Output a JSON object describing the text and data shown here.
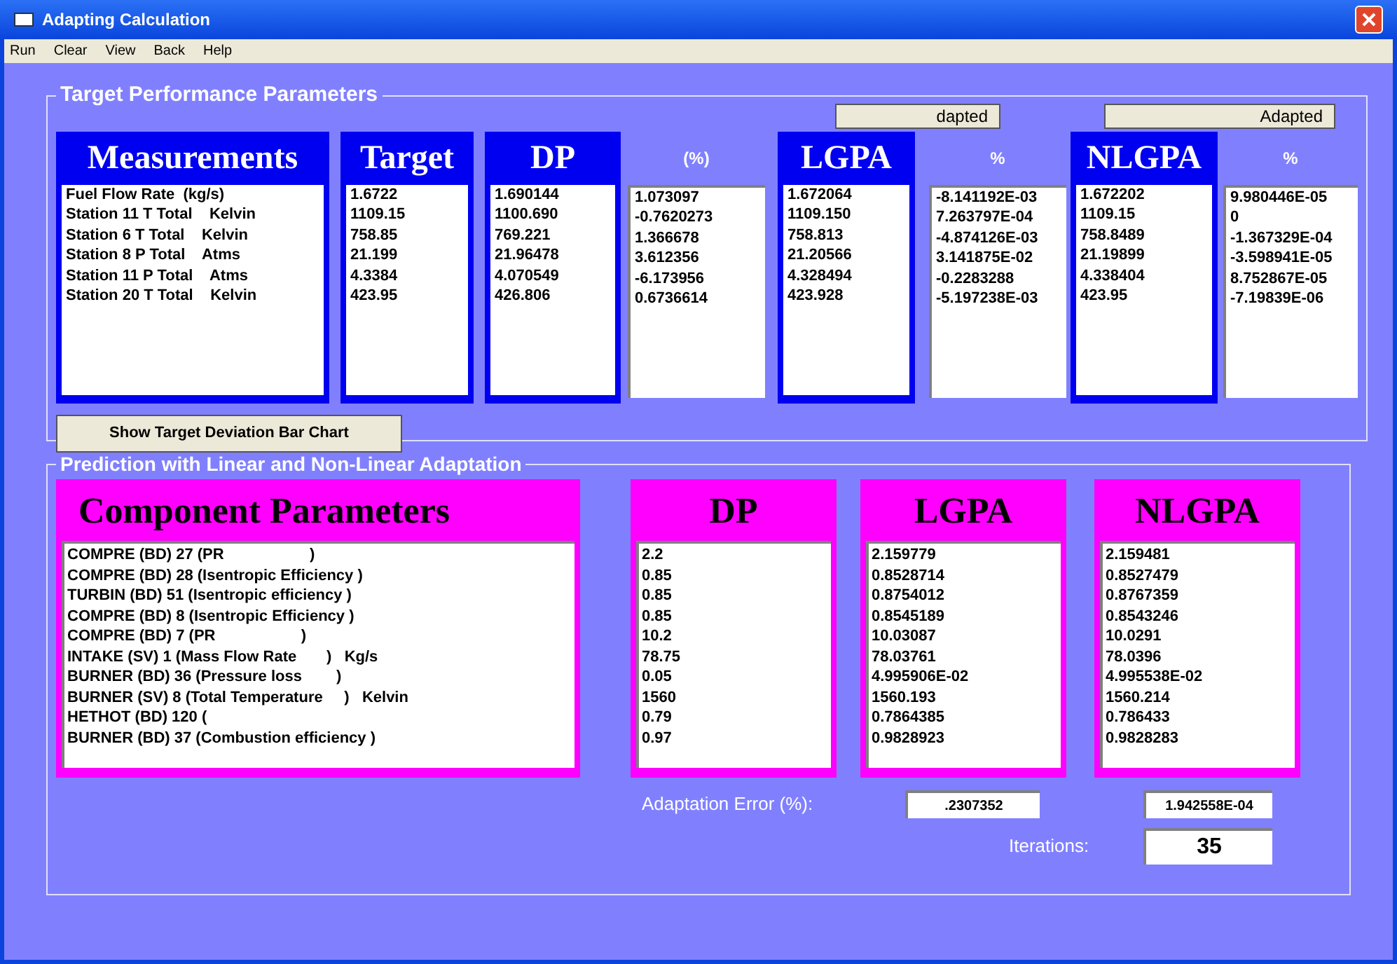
{
  "window": {
    "title": "Adapting Calculation"
  },
  "menu": [
    "Run",
    "Clear",
    "View",
    "Back",
    "Help"
  ],
  "target_group": {
    "title": "Target Performance Parameters",
    "buttons": [
      "dapted",
      "Adapted"
    ],
    "columns": [
      {
        "kind": "panel",
        "header": "Measurements",
        "rows": [
          "Fuel Flow Rate  (kg/s)",
          "Station 11 T Total    Kelvin",
          "Station 6 T Total    Kelvin",
          "Station 8 P Total    Atms",
          "Station 11 P Total    Atms",
          "Station 20 T Total    Kelvin"
        ]
      },
      {
        "kind": "panel",
        "header": "Target",
        "rows": [
          "1.6722",
          "1109.15",
          "758.85",
          "21.199",
          "4.3384",
          "423.95"
        ]
      },
      {
        "kind": "panel",
        "header": "DP",
        "rows": [
          "1.690144",
          "1100.690",
          "769.221",
          "21.96478",
          "4.070549",
          "426.806"
        ]
      },
      {
        "kind": "plain",
        "header": "(%)",
        "rows": [
          "1.073097",
          "-0.7620273",
          "1.366678",
          "3.612356",
          "-6.173956",
          "0.6736614"
        ]
      },
      {
        "kind": "panel",
        "header": "LGPA",
        "rows": [
          "1.672064",
          "1109.150",
          "758.813",
          "21.20566",
          "4.328494",
          "423.928"
        ]
      },
      {
        "kind": "plain",
        "header": "%",
        "rows": [
          "-8.141192E-03",
          "7.263797E-04",
          "-4.874126E-03",
          "3.141875E-02",
          "-0.2283288",
          "-5.197238E-03"
        ]
      },
      {
        "kind": "panel",
        "header": "NLGPA",
        "rows": [
          "1.672202",
          "1109.15",
          "758.8489",
          "21.19899",
          "4.338404",
          "423.95"
        ]
      },
      {
        "kind": "plain",
        "header": "%",
        "rows": [
          "9.980446E-05",
          "0",
          "-1.367329E-04",
          "-3.598941E-05",
          "8.752867E-05",
          "-7.19839E-06"
        ]
      }
    ],
    "chart_button": "Show Target Deviation Bar Chart"
  },
  "prediction_group": {
    "title": "Prediction with Linear and Non-Linear Adaptation",
    "columns": [
      {
        "kind": "wide",
        "header": "Component Parameters",
        "rows": [
          "COMPRE (BD) 27 (PR                    )",
          "COMPRE (BD) 28 (Isentropic Efficiency )",
          "TURBIN (BD) 51 (Isentropic efficiency )",
          "COMPRE (BD) 8 (Isentropic Efficiency )",
          "COMPRE (BD) 7 (PR                    )",
          "INTAKE (SV) 1 (Mass Flow Rate       )   Kg/s",
          "BURNER (BD) 36 (Pressure loss        )",
          "BURNER (SV) 8 (Total Temperature     )   Kelvin",
          "HETHOT (BD) 120 (",
          "BURNER (BD) 37 (Combustion efficiency )"
        ]
      },
      {
        "kind": "narrow",
        "header": "DP",
        "rows": [
          "2.2",
          "0.85",
          "0.85",
          "0.85",
          "10.2",
          "78.75",
          "0.05",
          "1560",
          "0.79",
          "0.97"
        ]
      },
      {
        "kind": "narrow",
        "header": "LGPA",
        "rows": [
          "2.159779",
          "0.8528714",
          "0.8754012",
          "0.8545189",
          "10.03087",
          "78.03761",
          "4.995906E-02",
          "1560.193",
          "0.7864385",
          "0.9828923"
        ]
      },
      {
        "kind": "narrow",
        "header": "NLGPA",
        "rows": [
          "2.159481",
          "0.8527479",
          "0.8767359",
          "0.8543246",
          "10.0291",
          "78.0396",
          "4.995538E-02",
          "1560.214",
          "0.786433",
          "0.9828283"
        ]
      }
    ],
    "adaptation_error": {
      "label": "Adaptation Error (%):",
      "values": [
        ".2307352",
        "1.942558E-04"
      ]
    },
    "iterations": {
      "label": "Iterations:",
      "value": "35"
    }
  }
}
